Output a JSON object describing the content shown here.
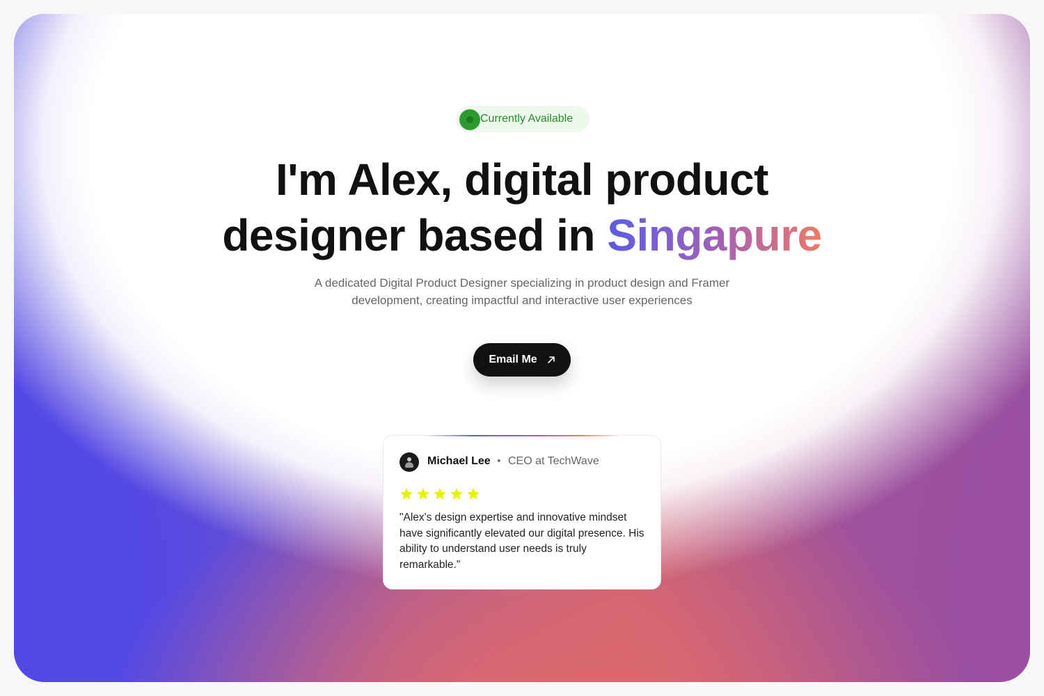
{
  "status": {
    "label": "Currently Available",
    "color": "#2d9a2d"
  },
  "hero": {
    "headline_line1": "I'm Alex, digital product",
    "headline_line2_prefix": "designer based in ",
    "headline_accent": "Singapure",
    "subtitle": "A dedicated Digital Product Designer specializing in product design and Framer development, creating impactful and interactive user experiences",
    "accent_gradient": [
      "#5b5ce6",
      "#a060b8",
      "#f07a66"
    ]
  },
  "cta": {
    "label": "Email Me",
    "icon": "arrow-up-right-icon"
  },
  "testimonial": {
    "author": "Michael Lee",
    "separator": "•",
    "role": "CEO at TechWave",
    "rating": 5,
    "rating_max": 5,
    "star_color": "#e6f500",
    "quote": "\"Alex's design expertise and innovative mindset have significantly elevated our digital presence. His ability to understand user needs is truly remarkable.\""
  }
}
